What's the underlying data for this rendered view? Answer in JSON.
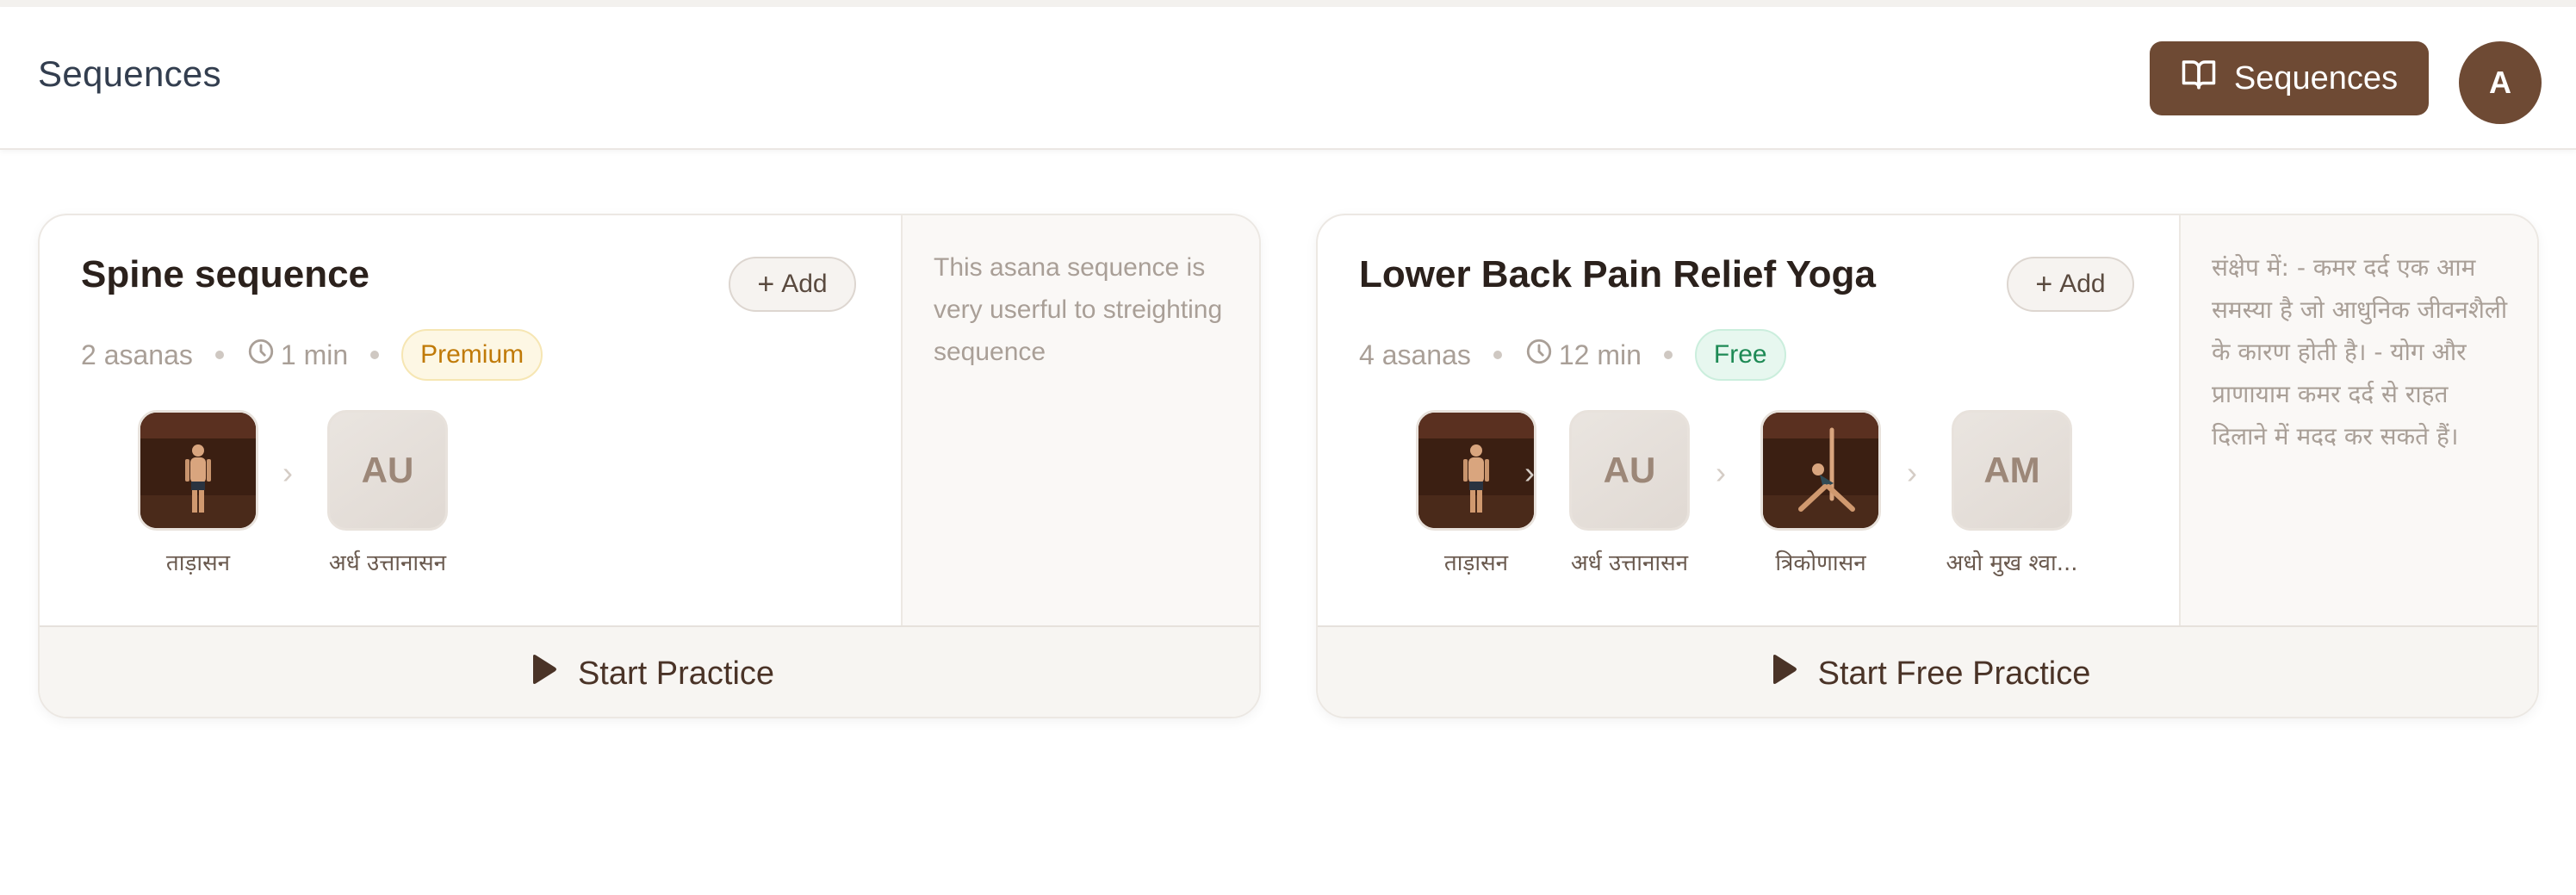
{
  "header": {
    "title": "Sequences",
    "nav_button_label": "Sequences",
    "nav_button_icon": "book-open-icon",
    "avatar_initial": "A"
  },
  "colors": {
    "brand": "#6e4a34",
    "premium": "#c07a08",
    "free": "#1e8a55"
  },
  "cards": [
    {
      "title": "Spine sequence",
      "add_label": "Add",
      "asana_count": "2 asanas",
      "duration": "1 min",
      "badge": "Premium",
      "description": "This asana sequence is very userful to streighting sequence",
      "asanas": [
        {
          "name": "ताड़ासन",
          "thumb": "image",
          "pose": "standing"
        },
        {
          "name": "अर्ध उत्तानासन",
          "thumb": "initials",
          "initials": "AU"
        }
      ],
      "action_label": "Start Practice"
    },
    {
      "title": "Lower Back Pain Relief Yoga",
      "add_label": "Add",
      "asana_count": "4 asanas",
      "duration": "12 min",
      "badge": "Free",
      "description": "संक्षेप में: - कमर दर्द एक आम समस्या है जो आधुनिक जीवनशैली के कारण होती है। - योग और प्राणायाम कमर दर्द से राहत दिलाने में मदद कर सकते हैं।",
      "asanas": [
        {
          "name": "ताड़ासन",
          "thumb": "image",
          "pose": "standing"
        },
        {
          "name": "अर्ध उत्तानासन",
          "thumb": "initials",
          "initials": "AU"
        },
        {
          "name": "त्रिकोणासन",
          "thumb": "image",
          "pose": "triangle"
        },
        {
          "name": "अधो मुख श्वा...",
          "thumb": "initials",
          "initials": "AM"
        }
      ],
      "action_label": "Start Free Practice"
    }
  ]
}
